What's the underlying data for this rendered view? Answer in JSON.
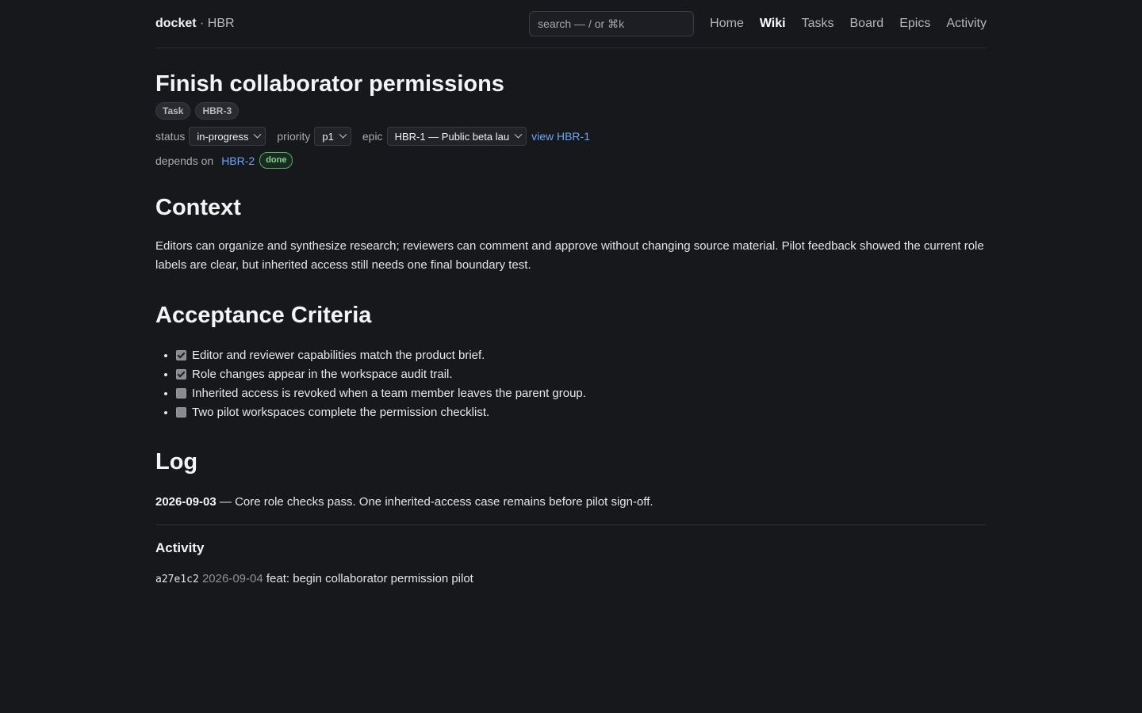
{
  "header": {
    "brand_name": "docket",
    "brand_sep": " · ",
    "brand_project": "HBR",
    "search_placeholder": "search — / or ⌘k",
    "nav": [
      {
        "label": "Home",
        "active": false
      },
      {
        "label": "Wiki",
        "active": true
      },
      {
        "label": "Tasks",
        "active": false
      },
      {
        "label": "Board",
        "active": false
      },
      {
        "label": "Epics",
        "active": false
      },
      {
        "label": "Activity",
        "active": false
      }
    ]
  },
  "task": {
    "title": "Finish collaborator permissions",
    "tags": [
      "Task",
      "HBR-3"
    ],
    "status_label": "status",
    "status_value": "in-progress",
    "priority_label": "priority",
    "priority_value": "p1",
    "epic_label": "epic",
    "epic_value": "HBR-1 — Public beta lau",
    "epic_link": "view HBR-1",
    "depends_label": "depends on",
    "depends_id": "HBR-2",
    "depends_status": "done"
  },
  "context": {
    "heading": "Context",
    "body": "Editors can organize and synthesize research; reviewers can comment and approve without changing source material. Pilot feedback showed the current role labels are clear, but inherited access still needs one final boundary test."
  },
  "acceptance": {
    "heading": "Acceptance Criteria",
    "items": [
      {
        "text": "Editor and reviewer capabilities match the product brief.",
        "checked": true
      },
      {
        "text": "Role changes appear in the workspace audit trail.",
        "checked": true
      },
      {
        "text": "Inherited access is revoked when a team member leaves the parent group.",
        "checked": false
      },
      {
        "text": "Two pilot workspaces complete the permission checklist.",
        "checked": false
      }
    ]
  },
  "log": {
    "heading": "Log",
    "date": "2026-09-03",
    "text": " — Core role checks pass. One inherited-access case remains before pilot sign-off."
  },
  "activity": {
    "heading": "Activity",
    "hash": "a27e1c2",
    "date": "2026-09-04",
    "message": "feat: begin collaborator permission pilot"
  },
  "colors": {
    "background": "#17181c",
    "link": "#6aa6f8",
    "done_badge": "#7fd68f"
  }
}
